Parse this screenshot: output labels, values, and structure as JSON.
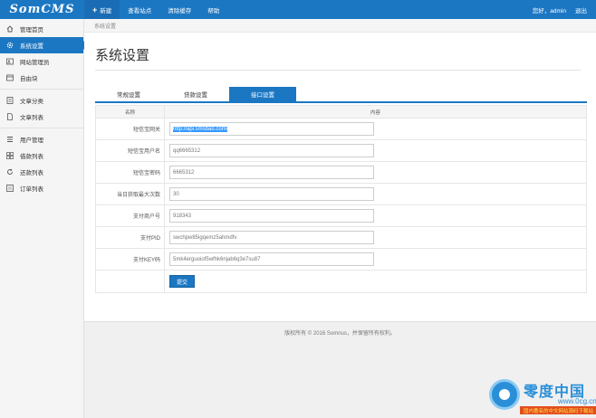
{
  "app": {
    "logo": "SomCMS"
  },
  "topnav": [
    {
      "label": "新建",
      "icon": "plus-icon"
    },
    {
      "label": "查看站点"
    },
    {
      "label": "清除缓存"
    },
    {
      "label": "帮助"
    }
  ],
  "user": {
    "greeting": "您好，admin",
    "logout": "退出"
  },
  "sidebar": {
    "items": [
      {
        "label": "管理首页",
        "icon": "home-icon"
      },
      {
        "label": "系统设置",
        "icon": "gear-icon",
        "active": true
      },
      {
        "label": "网站管理员",
        "icon": "admin-user-icon"
      },
      {
        "label": "自由块",
        "icon": "block-icon"
      },
      {
        "label": "文章分类",
        "icon": "category-icon"
      },
      {
        "label": "文章列表",
        "icon": "document-icon"
      },
      {
        "label": "用户管理",
        "icon": "user-icon"
      },
      {
        "label": "借款列表",
        "icon": "grid-icon"
      },
      {
        "label": "还款列表",
        "icon": "refresh-icon"
      },
      {
        "label": "订单列表",
        "icon": "order-icon"
      }
    ]
  },
  "breadcrumb": "系统设置",
  "page_title": "系统设置",
  "tabs": [
    {
      "label": "常规设置"
    },
    {
      "label": "贷款设置"
    },
    {
      "label": "接口设置",
      "active": true
    }
  ],
  "table": {
    "headers": {
      "name": "名称",
      "content": "内容"
    },
    "rows": [
      {
        "label": "短信宝网关",
        "value": "http://api.smsbao.com/",
        "selected": true
      },
      {
        "label": "短信宝用户名",
        "value": "qq6665312"
      },
      {
        "label": "短信宝密码",
        "value": "6665312"
      },
      {
        "label": "当日获取最大次数",
        "value": "30"
      },
      {
        "label": "支付商户号",
        "value": "918343"
      },
      {
        "label": "支付PID",
        "value": "swchpw85igqemz5ahmdfv"
      },
      {
        "label": "支付KEY码",
        "value": "5mk4erguoiof5wfhk6njab6q3e7su87"
      }
    ],
    "submit_label": "提交"
  },
  "footer": "版权所有 © 2016 Somnus，并保留所有权利。",
  "watermark": {
    "name": "零度中国",
    "url": "www.0cg.cn",
    "slogan": "国内著名的中文网站源码下载站"
  },
  "colors": {
    "primary": "#1c77c3",
    "watermark": "#2a8fd8"
  }
}
